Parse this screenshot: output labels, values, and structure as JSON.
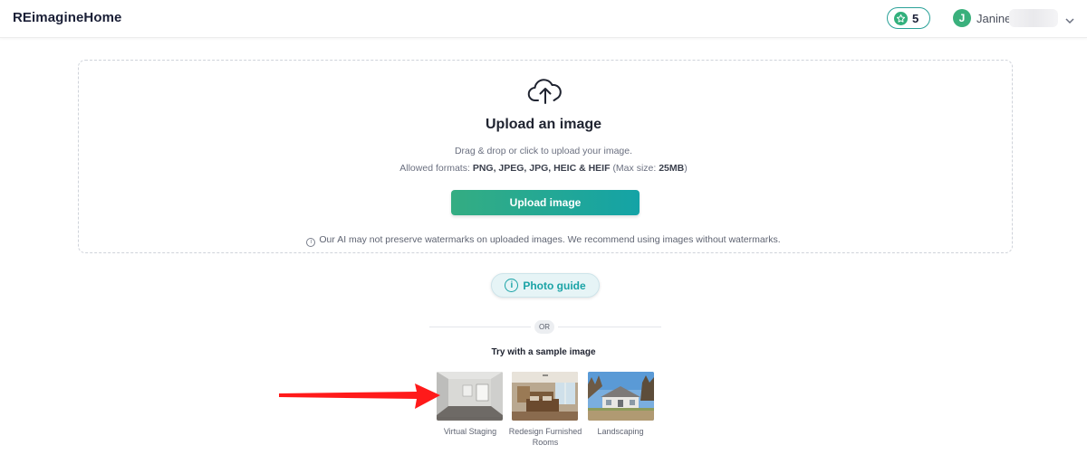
{
  "header": {
    "logo": "REimagineHome",
    "credits": "5",
    "avatar_initial": "J",
    "user_name": "Janine"
  },
  "upload": {
    "title": "Upload an image",
    "subtitle": "Drag & drop or click to upload your image.",
    "formats_prefix": "Allowed formats:",
    "formats": "PNG, JPEG, JPG, HEIC & HEIF",
    "max_size_prefix": "(Max size:",
    "max_size": "25MB",
    "max_size_suffix": ")",
    "button_label": "Upload image",
    "warning": "Our AI may not preserve watermarks on uploaded images. We recommend using images without watermarks."
  },
  "guide": {
    "label": "Photo guide"
  },
  "or_label": "OR",
  "samples": {
    "title": "Try with a sample image",
    "items": [
      {
        "label": "Virtual Staging"
      },
      {
        "label": "Redesign Furnished Rooms"
      },
      {
        "label": "Landscaping"
      }
    ]
  },
  "colors": {
    "accent_teal": "#1aa3a6",
    "accent_green": "#34ad82",
    "annotation_arrow": "#ff1a1a"
  }
}
